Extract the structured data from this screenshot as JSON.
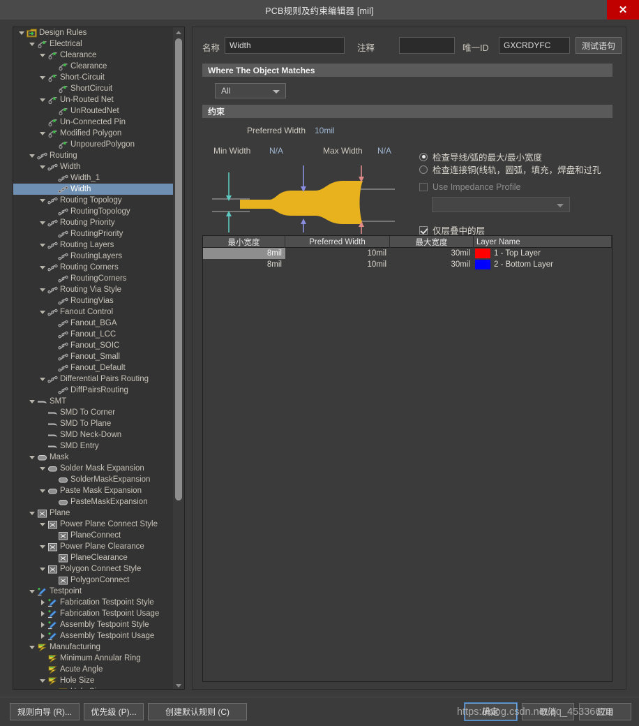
{
  "window": {
    "title": "PCB规则及约束编辑器 [mil]",
    "close_icon": "close-icon",
    "close_label": "✕"
  },
  "tree": {
    "items": [
      {
        "label": "Design Rules",
        "depth": 0,
        "arrow": "open",
        "icon": "design-rules-icon",
        "selected": false
      },
      {
        "label": "Electrical",
        "depth": 1,
        "arrow": "open",
        "icon": "electrical-icon",
        "selected": false
      },
      {
        "label": "Clearance",
        "depth": 2,
        "arrow": "open",
        "icon": "electrical-icon",
        "selected": false
      },
      {
        "label": "Clearance",
        "depth": 3,
        "arrow": "none",
        "icon": "electrical-icon",
        "selected": false
      },
      {
        "label": "Short-Circuit",
        "depth": 2,
        "arrow": "open",
        "icon": "electrical-icon",
        "selected": false
      },
      {
        "label": "ShortCircuit",
        "depth": 3,
        "arrow": "none",
        "icon": "electrical-icon",
        "selected": false
      },
      {
        "label": "Un-Routed Net",
        "depth": 2,
        "arrow": "open",
        "icon": "electrical-icon",
        "selected": false
      },
      {
        "label": "UnRoutedNet",
        "depth": 3,
        "arrow": "none",
        "icon": "electrical-icon",
        "selected": false
      },
      {
        "label": "Un-Connected Pin",
        "depth": 2,
        "arrow": "none",
        "icon": "electrical-icon",
        "selected": false
      },
      {
        "label": "Modified Polygon",
        "depth": 2,
        "arrow": "open",
        "icon": "electrical-icon",
        "selected": false
      },
      {
        "label": "UnpouredPolygon",
        "depth": 3,
        "arrow": "none",
        "icon": "electrical-icon",
        "selected": false
      },
      {
        "label": "Routing",
        "depth": 1,
        "arrow": "open",
        "icon": "routing-icon",
        "selected": false
      },
      {
        "label": "Width",
        "depth": 2,
        "arrow": "open",
        "icon": "routing-icon",
        "selected": false
      },
      {
        "label": "Width_1",
        "depth": 3,
        "arrow": "none",
        "icon": "routing-icon",
        "selected": false
      },
      {
        "label": "Width",
        "depth": 3,
        "arrow": "none",
        "icon": "routing-icon",
        "selected": true
      },
      {
        "label": "Routing Topology",
        "depth": 2,
        "arrow": "open",
        "icon": "routing-icon",
        "selected": false
      },
      {
        "label": "RoutingTopology",
        "depth": 3,
        "arrow": "none",
        "icon": "routing-icon",
        "selected": false
      },
      {
        "label": "Routing Priority",
        "depth": 2,
        "arrow": "open",
        "icon": "routing-icon",
        "selected": false
      },
      {
        "label": "RoutingPriority",
        "depth": 3,
        "arrow": "none",
        "icon": "routing-icon",
        "selected": false
      },
      {
        "label": "Routing Layers",
        "depth": 2,
        "arrow": "open",
        "icon": "routing-icon",
        "selected": false
      },
      {
        "label": "RoutingLayers",
        "depth": 3,
        "arrow": "none",
        "icon": "routing-icon",
        "selected": false
      },
      {
        "label": "Routing Corners",
        "depth": 2,
        "arrow": "open",
        "icon": "routing-icon",
        "selected": false
      },
      {
        "label": "RoutingCorners",
        "depth": 3,
        "arrow": "none",
        "icon": "routing-icon",
        "selected": false
      },
      {
        "label": "Routing Via Style",
        "depth": 2,
        "arrow": "open",
        "icon": "routing-icon",
        "selected": false
      },
      {
        "label": "RoutingVias",
        "depth": 3,
        "arrow": "none",
        "icon": "routing-icon",
        "selected": false
      },
      {
        "label": "Fanout Control",
        "depth": 2,
        "arrow": "open",
        "icon": "routing-icon",
        "selected": false
      },
      {
        "label": "Fanout_BGA",
        "depth": 3,
        "arrow": "none",
        "icon": "routing-icon",
        "selected": false
      },
      {
        "label": "Fanout_LCC",
        "depth": 3,
        "arrow": "none",
        "icon": "routing-icon",
        "selected": false
      },
      {
        "label": "Fanout_SOIC",
        "depth": 3,
        "arrow": "none",
        "icon": "routing-icon",
        "selected": false
      },
      {
        "label": "Fanout_Small",
        "depth": 3,
        "arrow": "none",
        "icon": "routing-icon",
        "selected": false
      },
      {
        "label": "Fanout_Default",
        "depth": 3,
        "arrow": "none",
        "icon": "routing-icon",
        "selected": false
      },
      {
        "label": "Differential Pairs Routing",
        "depth": 2,
        "arrow": "open",
        "icon": "routing-icon",
        "selected": false
      },
      {
        "label": "DiffPairsRouting",
        "depth": 3,
        "arrow": "none",
        "icon": "routing-icon",
        "selected": false
      },
      {
        "label": "SMT",
        "depth": 1,
        "arrow": "open",
        "icon": "smt-icon",
        "selected": false
      },
      {
        "label": "SMD To Corner",
        "depth": 2,
        "arrow": "none",
        "icon": "smt-icon",
        "selected": false
      },
      {
        "label": "SMD To Plane",
        "depth": 2,
        "arrow": "none",
        "icon": "smt-icon",
        "selected": false
      },
      {
        "label": "SMD Neck-Down",
        "depth": 2,
        "arrow": "none",
        "icon": "smt-icon",
        "selected": false
      },
      {
        "label": "SMD Entry",
        "depth": 2,
        "arrow": "none",
        "icon": "smt-icon",
        "selected": false
      },
      {
        "label": "Mask",
        "depth": 1,
        "arrow": "open",
        "icon": "mask-icon",
        "selected": false
      },
      {
        "label": "Solder Mask Expansion",
        "depth": 2,
        "arrow": "open",
        "icon": "mask-icon",
        "selected": false
      },
      {
        "label": "SolderMaskExpansion",
        "depth": 3,
        "arrow": "none",
        "icon": "mask-icon",
        "selected": false
      },
      {
        "label": "Paste Mask Expansion",
        "depth": 2,
        "arrow": "open",
        "icon": "mask-icon",
        "selected": false
      },
      {
        "label": "PasteMaskExpansion",
        "depth": 3,
        "arrow": "none",
        "icon": "mask-icon",
        "selected": false
      },
      {
        "label": "Plane",
        "depth": 1,
        "arrow": "open",
        "icon": "plane-icon",
        "selected": false
      },
      {
        "label": "Power Plane Connect Style",
        "depth": 2,
        "arrow": "open",
        "icon": "plane-icon",
        "selected": false
      },
      {
        "label": "PlaneConnect",
        "depth": 3,
        "arrow": "none",
        "icon": "plane-icon",
        "selected": false
      },
      {
        "label": "Power Plane Clearance",
        "depth": 2,
        "arrow": "open",
        "icon": "plane-icon",
        "selected": false
      },
      {
        "label": "PlaneClearance",
        "depth": 3,
        "arrow": "none",
        "icon": "plane-icon",
        "selected": false
      },
      {
        "label": "Polygon Connect Style",
        "depth": 2,
        "arrow": "open",
        "icon": "plane-icon",
        "selected": false
      },
      {
        "label": "PolygonConnect",
        "depth": 3,
        "arrow": "none",
        "icon": "plane-icon",
        "selected": false
      },
      {
        "label": "Testpoint",
        "depth": 1,
        "arrow": "open",
        "icon": "testpoint-icon",
        "selected": false
      },
      {
        "label": "Fabrication Testpoint Style",
        "depth": 2,
        "arrow": "closed",
        "icon": "testpoint-icon",
        "selected": false
      },
      {
        "label": "Fabrication Testpoint Usage",
        "depth": 2,
        "arrow": "closed",
        "icon": "testpoint-icon",
        "selected": false
      },
      {
        "label": "Assembly Testpoint Style",
        "depth": 2,
        "arrow": "closed",
        "icon": "testpoint-icon",
        "selected": false
      },
      {
        "label": "Assembly Testpoint Usage",
        "depth": 2,
        "arrow": "closed",
        "icon": "testpoint-icon",
        "selected": false
      },
      {
        "label": "Manufacturing",
        "depth": 1,
        "arrow": "open",
        "icon": "manufacturing-icon",
        "selected": false
      },
      {
        "label": "Minimum Annular Ring",
        "depth": 2,
        "arrow": "none",
        "icon": "manufacturing-icon",
        "selected": false
      },
      {
        "label": "Acute Angle",
        "depth": 2,
        "arrow": "none",
        "icon": "manufacturing-icon",
        "selected": false
      },
      {
        "label": "Hole Size",
        "depth": 2,
        "arrow": "open",
        "icon": "manufacturing-icon",
        "selected": false
      },
      {
        "label": "Hole Size",
        "depth": 3,
        "arrow": "none",
        "icon": "manufacturing-icon",
        "selected": false
      }
    ]
  },
  "form": {
    "name_label": "名称",
    "name_value": "Width",
    "comment_label": "注释",
    "comment_value": "",
    "unique_id_label": "唯一ID",
    "unique_id_value": "GXCRDYFC",
    "test_query_button": "测试语句"
  },
  "where_section": {
    "header": "Where The Object Matches",
    "scope_value": "All"
  },
  "constraint_section": {
    "header": "约束",
    "preferred_width_label": "Preferred Width",
    "preferred_width_value": "10mil",
    "min_width_label": "Min Width",
    "min_width_value": "N/A",
    "max_width_label": "Max Width",
    "max_width_value": "N/A",
    "radio_track_arc": "检查导线/弧的最大/最小宽度",
    "radio_copper_connect": "检查连接铜(线轨，圆弧，填充，焊盘和过孔",
    "impedance_checkbox_label": "Use Impedance Profile",
    "impedance_profile_value": "",
    "layers_in_stack_label": "仅层叠中的层"
  },
  "table": {
    "headers": [
      "最小宽度",
      "Preferred Width",
      "最大宽度",
      "Layer Name"
    ],
    "rows": [
      {
        "min": "8mil",
        "preferred": "10mil",
        "max": "30mil",
        "color": "#ff0000",
        "layer": "1 - Top Layer",
        "selected": true
      },
      {
        "min": "8mil",
        "preferred": "10mil",
        "max": "30mil",
        "color": "#0000ff",
        "layer": "2 - Bottom Layer",
        "selected": false
      }
    ]
  },
  "footer": {
    "rule_wizard": "规则向导 (R)...",
    "priority": "优先级 (P)...",
    "create_default_rules": "创建默认规则 (C)",
    "ok": "确定",
    "cancel": "取消",
    "apply": "应用"
  },
  "watermark": {
    "text": "https://blog.csdn.net/qq_45336672"
  }
}
